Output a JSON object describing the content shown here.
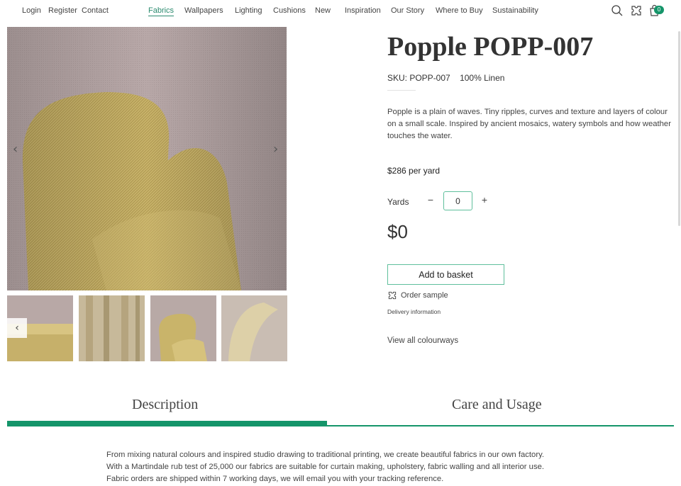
{
  "header": {
    "left_links": [
      "Login",
      "Register",
      "Contact"
    ],
    "nav": [
      "Fabrics",
      "Wallpapers",
      "Lighting",
      "Cushions",
      "New",
      "Inspiration",
      "Our Story",
      "Where to Buy",
      "Sustainability"
    ],
    "active_nav": "Fabrics",
    "icons": [
      "search-icon",
      "sample-icon",
      "basket-icon"
    ],
    "basket_count": "0"
  },
  "gallery": {
    "prev_arrow": "‹",
    "next_arrow": "›",
    "thumbnails": [
      "sofa",
      "curtains",
      "chair",
      "chair-detail"
    ]
  },
  "product": {
    "title": "Popple POPP-007",
    "sku": "SKU: POPP-007",
    "composition": "100% Linen",
    "description": "Popple is a plain of waves. Tiny ripples, curves and texture and layers of colour on a small scale. Inspired by ancient mosaics, watery symbols and how weather touches the water.",
    "price": "$286 per yard",
    "yards_label": "Yards",
    "qty_minus": "−",
    "qty_value": "0",
    "qty_plus": "+",
    "total": "$0",
    "add_to_basket": "Add to basket",
    "order_sample": "Order sample",
    "delivery_info": "Delivery information",
    "view_colourways": "View all colourways"
  },
  "tabs": {
    "items": [
      "Description",
      "Care and Usage"
    ],
    "active": "Description"
  },
  "description_body": [
    "From mixing natural colours and inspired studio drawing to traditional printing, we create beautiful fabrics in our own factory.",
    "With a Martindale rub test of 25,000 our fabrics are suitable for curtain making, upholstery, fabric walling and all interior use.",
    "Fabric orders are shipped within 7 working days, we will email you with your tracking reference."
  ],
  "colors": {
    "accent": "#15956a",
    "accent_light": "#5fbf9c",
    "fabric": "#c9b46a",
    "wall": "#b9a9a8"
  }
}
